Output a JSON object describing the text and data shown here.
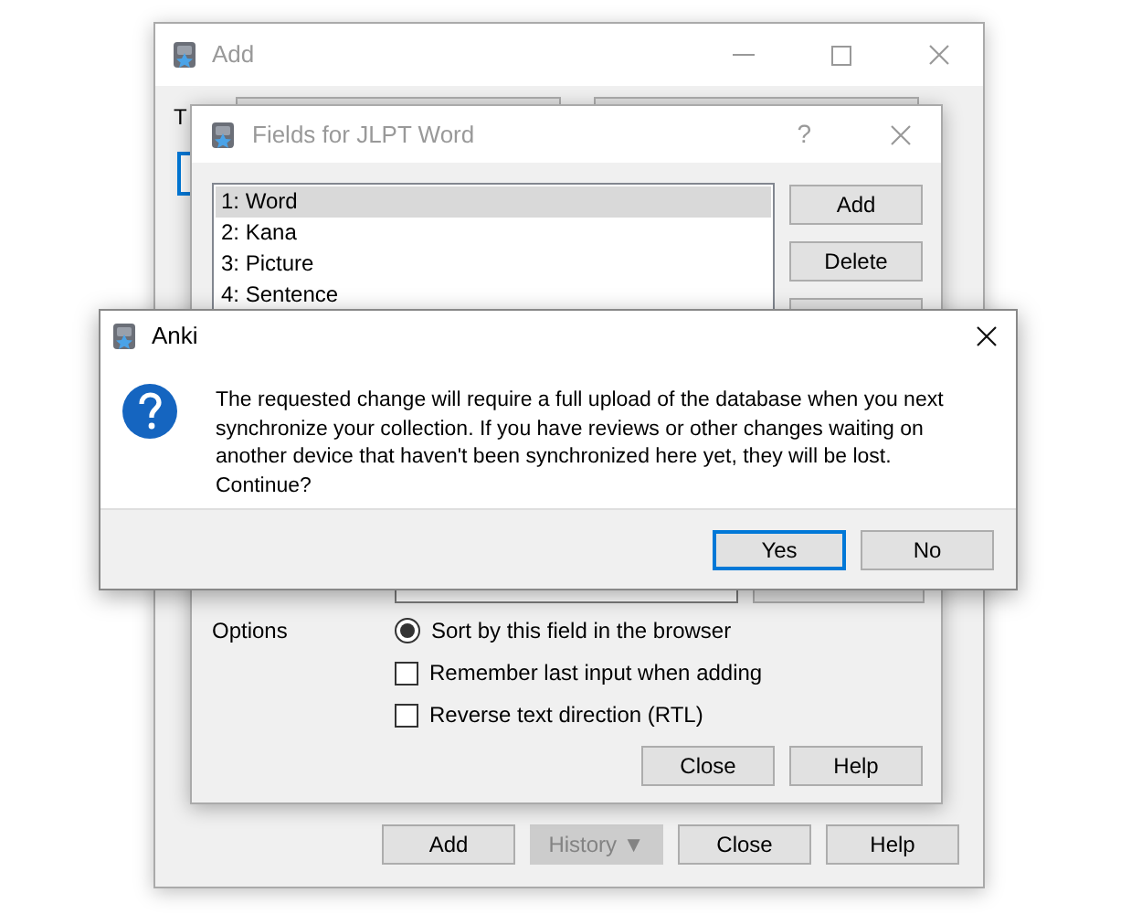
{
  "add_window": {
    "title": "Add",
    "type_label": "T",
    "buttons": [
      {
        "label": "Add",
        "disabled": false
      },
      {
        "label": "History ▼",
        "disabled": true
      },
      {
        "label": "Close",
        "disabled": false
      },
      {
        "label": "Help",
        "disabled": false
      }
    ]
  },
  "fields_window": {
    "title": "Fields for JLPT Word",
    "help_glyph": "?",
    "fields": [
      {
        "label": "1: Word",
        "selected": true
      },
      {
        "label": "2: Kana",
        "selected": false
      },
      {
        "label": "3: Picture",
        "selected": false
      },
      {
        "label": "4: Sentence",
        "selected": false
      }
    ],
    "side_buttons": [
      "Add",
      "Delete"
    ],
    "options_label": "Options",
    "options": [
      {
        "kind": "radio",
        "label": "Sort by this field in the browser",
        "checked": true
      },
      {
        "kind": "checkbox",
        "label": "Remember last input when adding",
        "checked": false
      },
      {
        "kind": "checkbox",
        "label": "Reverse text direction (RTL)",
        "checked": false
      }
    ],
    "buttons": [
      "Close",
      "Help"
    ]
  },
  "dialog": {
    "title": "Anki",
    "message": "The requested change will require a full upload of the database when you next synchronize your collection. If you have reviews or other changes waiting on another device that haven't been synchronized here yet, they will be lost. Continue?",
    "buttons": [
      {
        "label": "Yes",
        "selected": true
      },
      {
        "label": "No",
        "selected": false
      }
    ]
  }
}
